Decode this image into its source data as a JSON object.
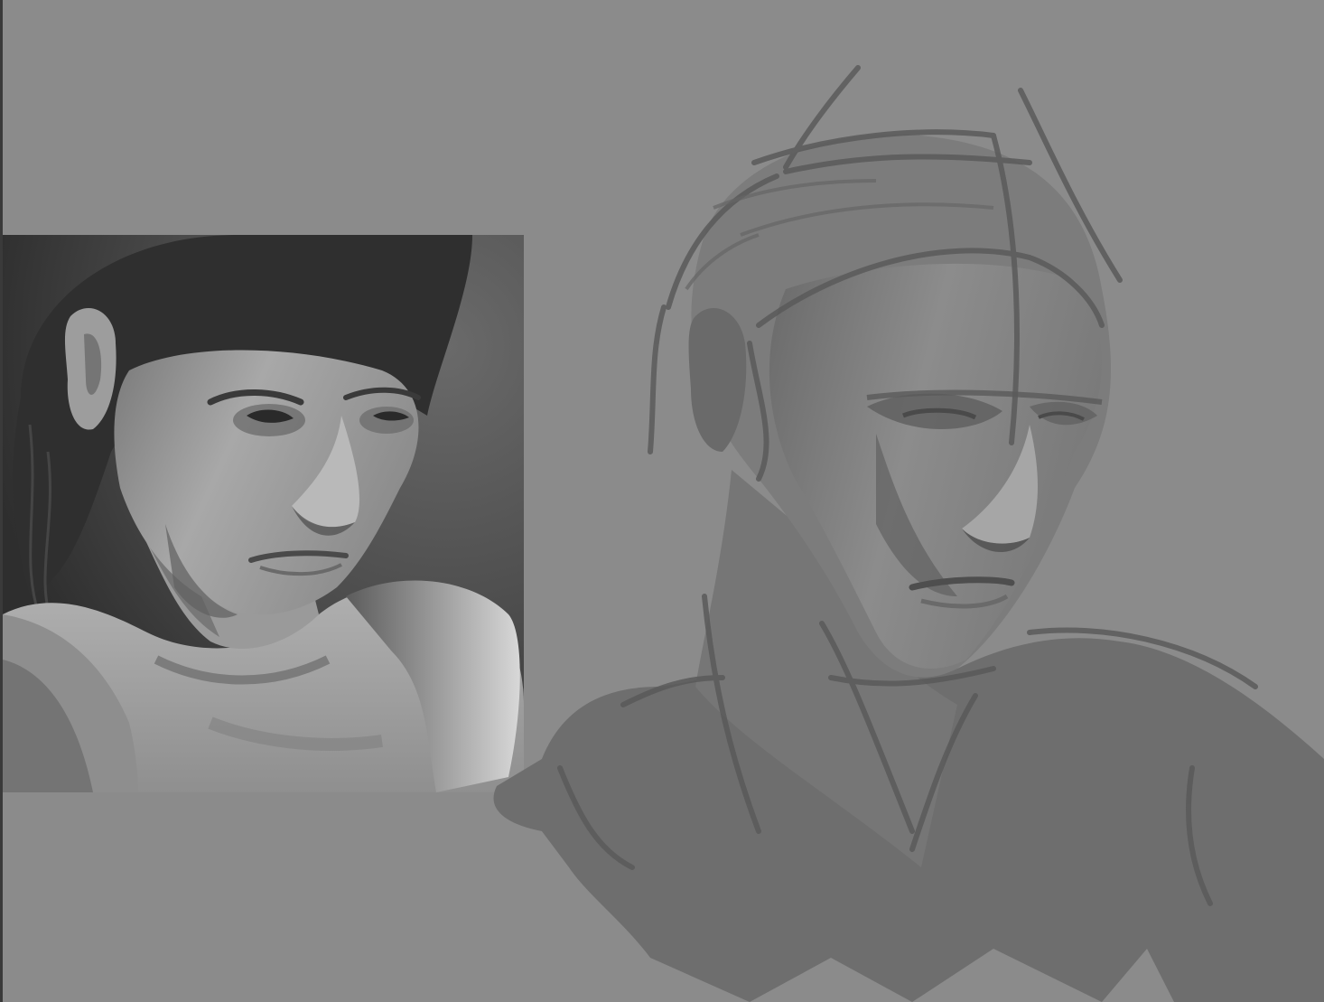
{
  "canvas": {
    "background_color": "#8b8b8b",
    "edge_color": "#3a3a3a"
  },
  "reference_photo": {
    "kind": "black-and-white portrait reference",
    "background_color": "#3f3f3f"
  },
  "sketch": {
    "kind": "digital grayscale painting study",
    "stroke_color": "#5c5c5c",
    "mass_color": "#6e6e6e"
  }
}
